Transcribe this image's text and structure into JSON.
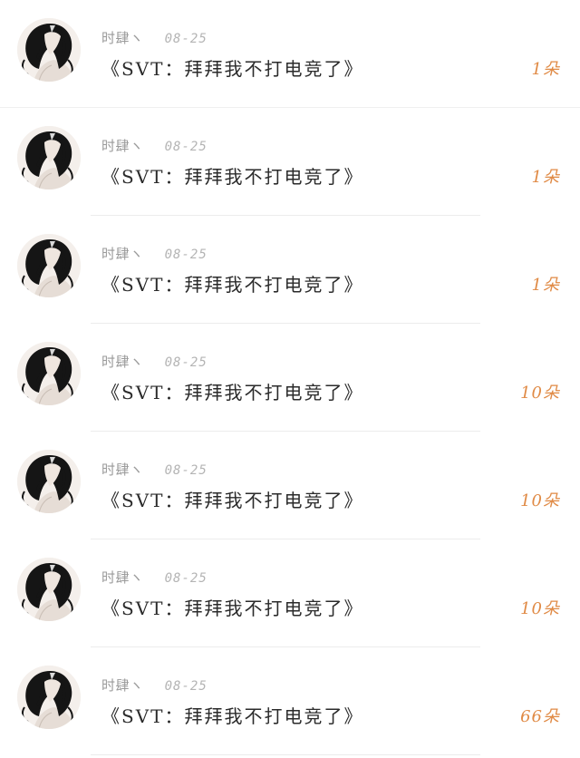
{
  "list": {
    "items": [
      {
        "nickname": "时肆ヽ",
        "date": "08-25",
        "message": "《SVT：拜拜我不打电竞了》",
        "amount": "1朵"
      },
      {
        "nickname": "时肆ヽ",
        "date": "08-25",
        "message": "《SVT：拜拜我不打电竞了》",
        "amount": "1朵"
      },
      {
        "nickname": "时肆ヽ",
        "date": "08-25",
        "message": "《SVT：拜拜我不打电竞了》",
        "amount": "1朵"
      },
      {
        "nickname": "时肆ヽ",
        "date": "08-25",
        "message": "《SVT：拜拜我不打电竞了》",
        "amount": "10朵"
      },
      {
        "nickname": "时肆ヽ",
        "date": "08-25",
        "message": "《SVT：拜拜我不打电竞了》",
        "amount": "10朵"
      },
      {
        "nickname": "时肆ヽ",
        "date": "08-25",
        "message": "《SVT：拜拜我不打电竞了》",
        "amount": "10朵"
      },
      {
        "nickname": "时肆ヽ",
        "date": "08-25",
        "message": "《SVT：拜拜我不打电竞了》",
        "amount": "66朵"
      }
    ]
  },
  "colors": {
    "accent": "#e08a45",
    "nickname": "#9a9a9a",
    "date": "#b4b4b4",
    "message": "#2b2b2b",
    "divider": "#ececec"
  },
  "icons": {
    "avatar": "anime-avatar-image"
  }
}
